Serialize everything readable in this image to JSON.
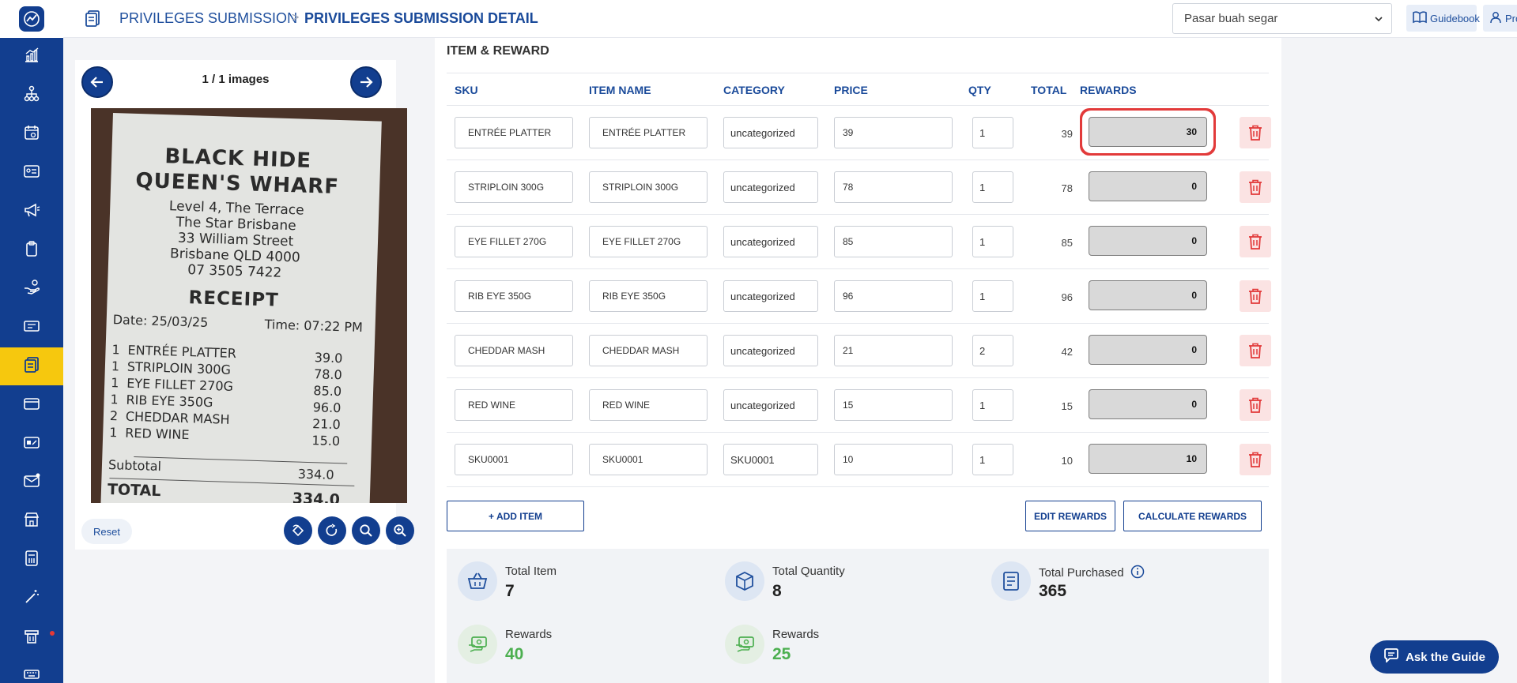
{
  "header": {
    "breadcrumb_parent": "PRIVILEGES SUBMISSION",
    "breadcrumb_separator": ">",
    "breadcrumb_current": "PRIVILEGES SUBMISSION DETAIL",
    "store_selected": "Pasar buah segar",
    "guidebook_label": "Guidebook",
    "profile_label": "Profile"
  },
  "sidebar": {
    "items": [
      {
        "icon": "chart-icon"
      },
      {
        "icon": "hierarchy-icon"
      },
      {
        "icon": "calendar-icon"
      },
      {
        "icon": "id-card-icon"
      },
      {
        "icon": "megaphone-icon"
      },
      {
        "icon": "clipboard-icon"
      },
      {
        "icon": "hand-coin-icon"
      },
      {
        "icon": "ticket-icon"
      },
      {
        "icon": "receipt-icon",
        "active": true
      },
      {
        "icon": "card-icon"
      },
      {
        "icon": "voucher-icon"
      },
      {
        "icon": "mail-icon"
      },
      {
        "icon": "store-icon"
      },
      {
        "icon": "calculator-icon"
      },
      {
        "icon": "magic-wand-icon"
      },
      {
        "icon": "printer-icon"
      },
      {
        "icon": "keyboard-icon"
      }
    ]
  },
  "image_viewer": {
    "count_label": "1 / 1 images",
    "reset_label": "Reset",
    "receipt": {
      "title_line1": "BLACK HIDE",
      "title_line2": "QUEEN'S WHARF",
      "address_line1": "Level 4, The Terrace",
      "address_line2": "The Star Brisbane",
      "address_line3": "33 William Street",
      "address_line4": "Brisbane QLD 4000",
      "phone": "07 3505 7422",
      "heading": "RECEIPT",
      "date": "Date: 25/03/25",
      "time": "Time: 07:22 PM",
      "lines": [
        {
          "qty": "1",
          "name": "ENTRÉE PLATTER",
          "amount": "39.0"
        },
        {
          "qty": "1",
          "name": "STRIPLOIN 300G",
          "amount": "78.0"
        },
        {
          "qty": "1",
          "name": "EYE FILLET 270G",
          "amount": "85.0"
        },
        {
          "qty": "1",
          "name": "RIB EYE 350G",
          "amount": "96.0"
        },
        {
          "qty": "2",
          "name": "CHEDDAR MASH",
          "amount": "21.0"
        },
        {
          "qty": "1",
          "name": "RED WINE",
          "amount": "15.0"
        }
      ],
      "subtotal_label": "Subtotal",
      "subtotal_value": "334.0",
      "total_label": "TOTAL",
      "total_value": "334.0"
    }
  },
  "items": {
    "section_title": "ITEM & REWARD",
    "columns": [
      "SKU",
      "ITEM NAME",
      "CATEGORY",
      "PRICE",
      "QTY",
      "TOTAL",
      "REWARDS"
    ],
    "rows": [
      {
        "sku": "ENTRÉE PLATTER",
        "name": "ENTRÉE PLATTER",
        "category": "uncategorized",
        "price": "39",
        "qty": "1",
        "total": "39",
        "reward": "30"
      },
      {
        "sku": "STRIPLOIN 300G",
        "name": "STRIPLOIN 300G",
        "category": "uncategorized",
        "price": "78",
        "qty": "1",
        "total": "78",
        "reward": "0"
      },
      {
        "sku": "EYE FILLET 270G",
        "name": "EYE FILLET 270G",
        "category": "uncategorized",
        "price": "85",
        "qty": "1",
        "total": "85",
        "reward": "0"
      },
      {
        "sku": "RIB EYE 350G",
        "name": "RIB EYE 350G",
        "category": "uncategorized",
        "price": "96",
        "qty": "1",
        "total": "96",
        "reward": "0"
      },
      {
        "sku": "CHEDDAR MASH",
        "name": "CHEDDAR MASH",
        "category": "uncategorized",
        "price": "21",
        "qty": "2",
        "total": "42",
        "reward": "0"
      },
      {
        "sku": "RED WINE",
        "name": "RED WINE",
        "category": "uncategorized",
        "price": "15",
        "qty": "1",
        "total": "15",
        "reward": "0"
      },
      {
        "sku": "SKU0001",
        "name": "SKU0001",
        "category": "SKU0001",
        "price": "10",
        "qty": "1",
        "total": "10",
        "reward": "10"
      }
    ],
    "add_item_label": "+ ADD ITEM",
    "edit_rewards_label": "EDIT REWARDS",
    "calculate_rewards_label": "CALCULATE REWARDS"
  },
  "summary": {
    "total_item_label": "Total Item",
    "total_item_value": "7",
    "total_quantity_label": "Total Quantity",
    "total_quantity_value": "8",
    "total_purchased_label": "Total Purchased",
    "total_purchased_value": "365",
    "rewards1_label": "Rewards",
    "rewards1_value": "40",
    "rewards2_label": "Rewards",
    "rewards2_value": "25"
  },
  "ask_guide_label": "Ask the Guide",
  "colors": {
    "sidebar": "#123e8f",
    "active": "#f6c80e",
    "accent": "#1a4a9a",
    "reward_green": "#4caf50",
    "highlight_red": "#e23a3a"
  }
}
